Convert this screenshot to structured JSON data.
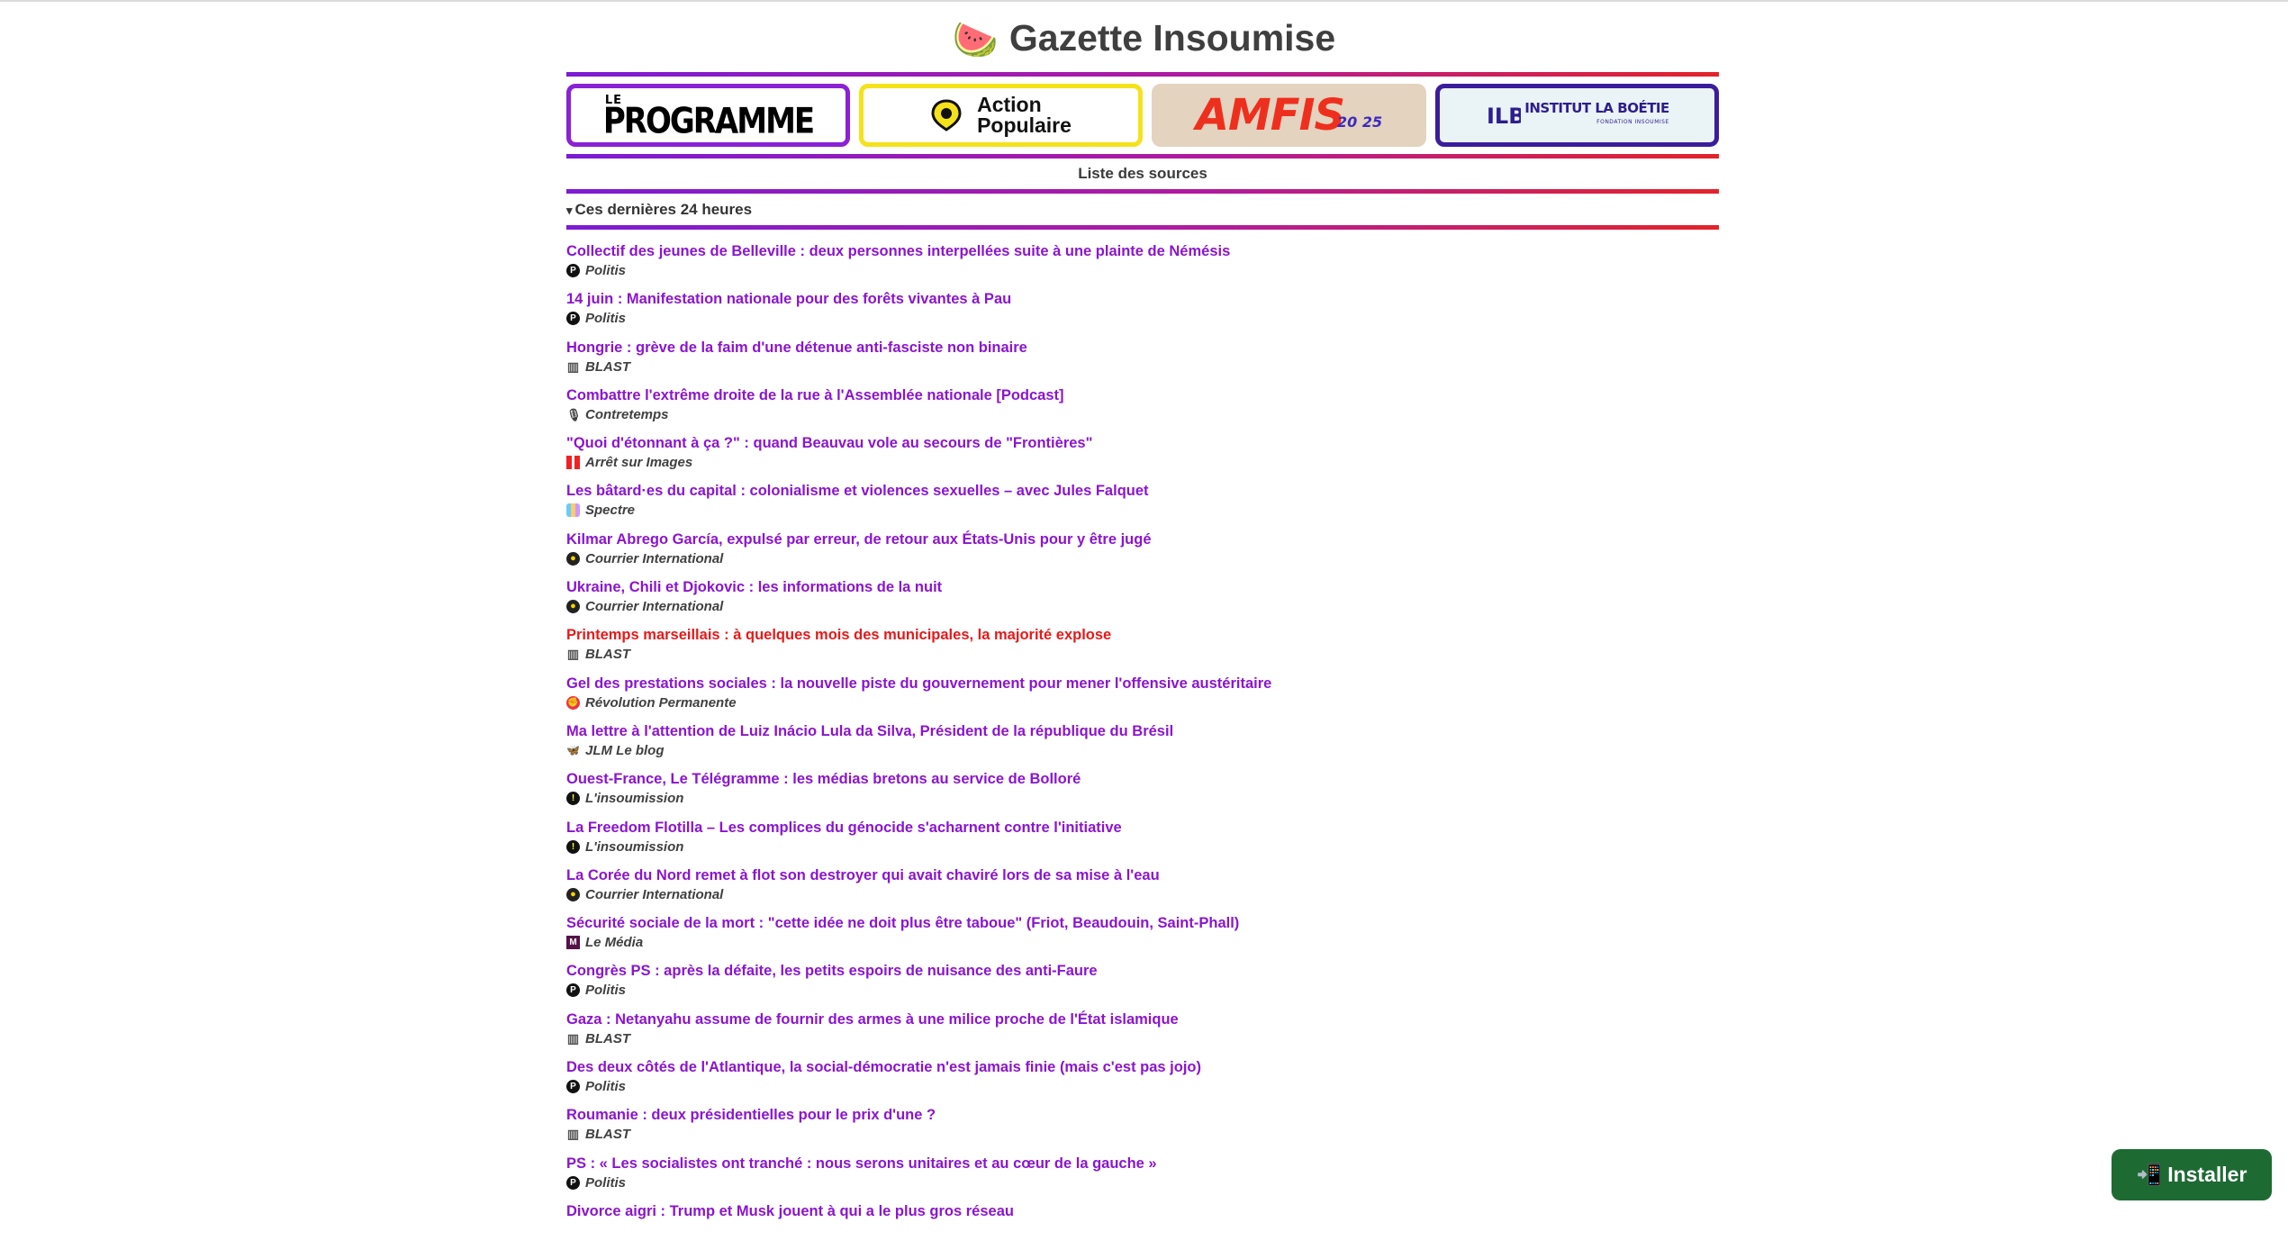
{
  "app": {
    "title": "Gazette Insoumise",
    "logo_emoji": "🍉"
  },
  "banners": [
    {
      "name": "Le Programme",
      "line1": "LE",
      "line2": "PROGRAMME"
    },
    {
      "name": "Action Populaire",
      "line1": "Action",
      "line2": "Populaire"
    },
    {
      "name": "AMFIS 2025",
      "line1": "AMFIS",
      "line2": "20 25"
    },
    {
      "name": "Institut La Boétie",
      "line1": "INSTITUT LA BOÉTIE",
      "line2": "FONDATION INSOUMISE"
    }
  ],
  "sources_link": "Liste des sources",
  "section": {
    "arrow": "▾",
    "label": "Ces dernières 24 heures"
  },
  "articles": [
    {
      "title": "Collectif des jeunes de Belleville : deux personnes interpellées suite à une plainte de Némésis",
      "source": "Politis",
      "icon": "politis-icon",
      "highlight": false
    },
    {
      "title": "14 juin : Manifestation nationale pour des forêts vivantes à Pau",
      "source": "Politis",
      "icon": "politis-icon",
      "highlight": false
    },
    {
      "title": "Hongrie : grève de la faim d'une détenue anti-fasciste non binaire",
      "source": "BLAST",
      "icon": "blast-icon",
      "highlight": false
    },
    {
      "title": "Combattre l'extrême droite de la rue à l'Assemblée nationale [Podcast]",
      "source": "Contretemps",
      "icon": "contretemps-icon",
      "highlight": false
    },
    {
      "title": "\"Quoi d'étonnant à ça ?\" : quand Beauvau vole au secours de \"Frontières\"",
      "source": "Arrêt sur Images",
      "icon": "arret-sur-images-icon",
      "highlight": false
    },
    {
      "title": "Les bâtard·es du capital : colonialisme et violences sexuelles – avec Jules Falquet",
      "source": "Spectre",
      "icon": "spectre-icon",
      "highlight": false
    },
    {
      "title": "Kilmar Abrego García, expulsé par erreur, de retour aux États-Unis pour y être jugé",
      "source": "Courrier International",
      "icon": "courrier-international-icon",
      "highlight": false
    },
    {
      "title": "Ukraine, Chili et Djokovic : les informations de la nuit",
      "source": "Courrier International",
      "icon": "courrier-international-icon",
      "highlight": false
    },
    {
      "title": "Printemps marseillais : à quelques mois des municipales, la majorité explose",
      "source": "BLAST",
      "icon": "blast-icon",
      "highlight": true
    },
    {
      "title": "Gel des prestations sociales : la nouvelle piste du gouvernement pour mener l'offensive austéritaire",
      "source": "Révolution Permanente",
      "icon": "revolution-permanente-icon",
      "highlight": false
    },
    {
      "title": "Ma lettre à l'attention de Luiz Inácio Lula da Silva, Président de la république du Brésil",
      "source": "JLM Le blog",
      "icon": "jlm-blog-icon",
      "highlight": false
    },
    {
      "title": "Ouest-France, Le Télégramme : les médias bretons au service de Bolloré",
      "source": "L'insoumission",
      "icon": "linsoumission-icon",
      "highlight": false
    },
    {
      "title": "La Freedom Flotilla – Les complices du génocide s'acharnent contre l'initiative",
      "source": "L'insoumission",
      "icon": "linsoumission-icon",
      "highlight": false
    },
    {
      "title": "La Corée du Nord remet à flot son destroyer qui avait chaviré lors de sa mise à l'eau",
      "source": "Courrier International",
      "icon": "courrier-international-icon",
      "highlight": false
    },
    {
      "title": "Sécurité sociale de la mort : \"cette idée ne doit plus être taboue\" (Friot, Beaudouin, Saint-Phall)",
      "source": "Le Média",
      "icon": "le-media-icon",
      "highlight": false
    },
    {
      "title": "Congrès PS : après la défaite, les petits espoirs de nuisance des anti-Faure",
      "source": "Politis",
      "icon": "politis-icon",
      "highlight": false
    },
    {
      "title": "Gaza : Netanyahu assume de fournir des armes à une milice proche de l'État islamique",
      "source": "BLAST",
      "icon": "blast-icon",
      "highlight": false
    },
    {
      "title": "Des deux côtés de l'Atlantique, la social-démocratie n'est jamais finie (mais c'est pas jojo)",
      "source": "Politis",
      "icon": "politis-icon",
      "highlight": false
    },
    {
      "title": "Roumanie : deux présidentielles pour le prix d'une ?",
      "source": "BLAST",
      "icon": "blast-icon",
      "highlight": false
    },
    {
      "title": "PS : « Les socialistes ont tranché : nous serons unitaires et au cœur de la gauche »",
      "source": "Politis",
      "icon": "politis-icon",
      "highlight": false
    },
    {
      "title": "Divorce aigri : Trump et Musk jouent à qui a le plus gros réseau",
      "source": "",
      "icon": "",
      "highlight": false
    }
  ],
  "install_button": {
    "icon": "📲",
    "label": "Installer"
  },
  "colors": {
    "link": "#8a15cf",
    "highlight": "#e51919",
    "install_bg": "#1d6b33",
    "gradient_start": "#7c1bd4",
    "gradient_end": "#e3232a"
  }
}
